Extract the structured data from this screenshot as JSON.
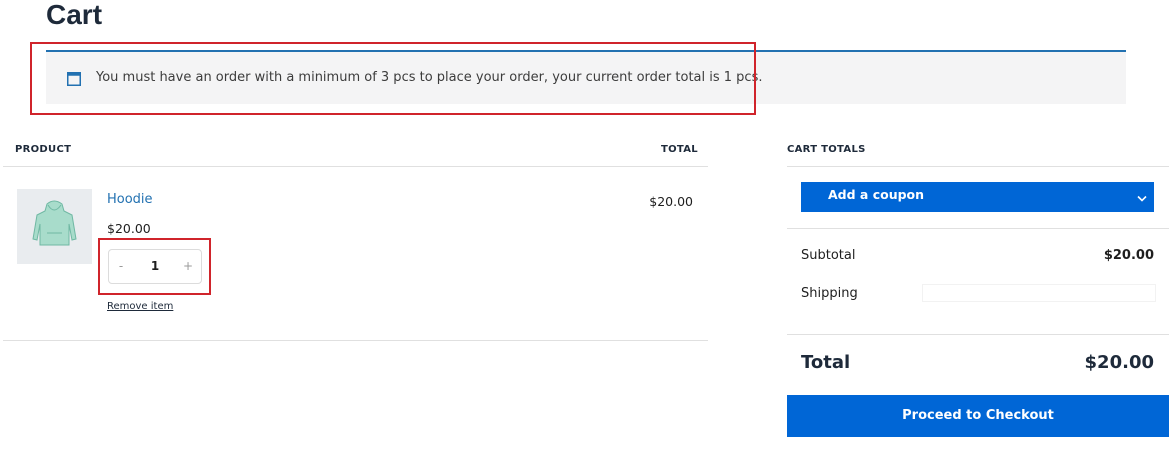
{
  "page": {
    "title": "Cart"
  },
  "notice": {
    "icon": "notice-info-icon",
    "text": "You must have an order with a minimum of 3 pcs to place your order, your current order total is 1 pcs."
  },
  "table": {
    "headers": {
      "product": "PRODUCT",
      "total": "TOTAL"
    },
    "items": [
      {
        "name": "Hoodie",
        "price": "$20.00",
        "quantity": "1",
        "line_total": "$20.00",
        "remove_label": "Remove item",
        "qty_minus": "-",
        "qty_plus": "+",
        "thumbnail_icon": "hoodie-icon"
      }
    ]
  },
  "cart_totals": {
    "heading": "CART TOTALS",
    "coupon_label": "Add a coupon",
    "subtotal_label": "Subtotal",
    "subtotal_value": "$20.00",
    "shipping_label": "Shipping",
    "total_label": "Total",
    "total_value": "$20.00",
    "checkout_label": "Proceed to Checkout"
  },
  "colors": {
    "accent": "#0066d6",
    "link": "#2271b1",
    "highlight": "#d0242b",
    "notice_bg": "#f4f4f5"
  }
}
